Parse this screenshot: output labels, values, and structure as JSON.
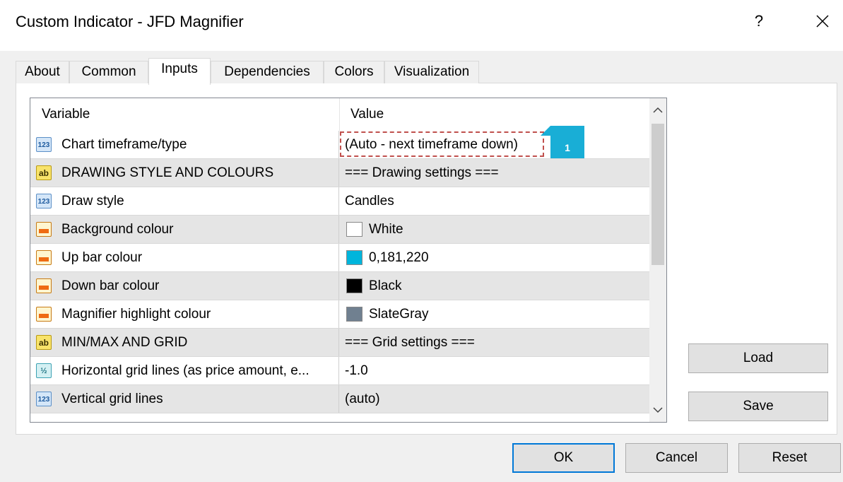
{
  "window": {
    "title": "Custom Indicator - JFD Magnifier",
    "help_label": "?"
  },
  "tabs": [
    {
      "label": "About"
    },
    {
      "label": "Common"
    },
    {
      "label": "Inputs",
      "active": true
    },
    {
      "label": "Dependencies"
    },
    {
      "label": "Colors"
    },
    {
      "label": "Visualization"
    }
  ],
  "grid": {
    "headers": {
      "variable": "Variable",
      "value": "Value"
    },
    "rows": [
      {
        "type": "num",
        "icon_text": "123",
        "label": "Chart timeframe/type",
        "value": "(Auto - next timeframe down)",
        "selected": true
      },
      {
        "type": "str",
        "icon_text": "ab",
        "label": "DRAWING STYLE AND COLOURS",
        "value": "=== Drawing settings ==="
      },
      {
        "type": "num",
        "icon_text": "123",
        "label": "Draw style",
        "value": "Candles"
      },
      {
        "type": "clr",
        "label": "Background colour",
        "value": "White",
        "swatch": "#ffffff"
      },
      {
        "type": "clr",
        "label": "Up bar colour",
        "value": "0,181,220",
        "swatch": "#00b5dc"
      },
      {
        "type": "clr",
        "label": "Down bar colour",
        "value": "Black",
        "swatch": "#000000"
      },
      {
        "type": "clr",
        "label": "Magnifier highlight colour",
        "value": "SlateGray",
        "swatch": "#708090"
      },
      {
        "type": "str",
        "icon_text": "ab",
        "label": "MIN/MAX AND GRID",
        "value": "=== Grid settings ==="
      },
      {
        "type": "dbl",
        "icon_text": "½",
        "label": "Horizontal grid lines (as price amount, e...",
        "value": "-1.0"
      },
      {
        "type": "num",
        "icon_text": "123",
        "label": "Vertical grid lines",
        "value": "(auto)"
      }
    ]
  },
  "callout": {
    "number": "1",
    "color": "#19aed6"
  },
  "side_buttons": {
    "load": "Load",
    "save": "Save"
  },
  "bottom_buttons": {
    "ok": "OK",
    "cancel": "Cancel",
    "reset": "Reset"
  }
}
